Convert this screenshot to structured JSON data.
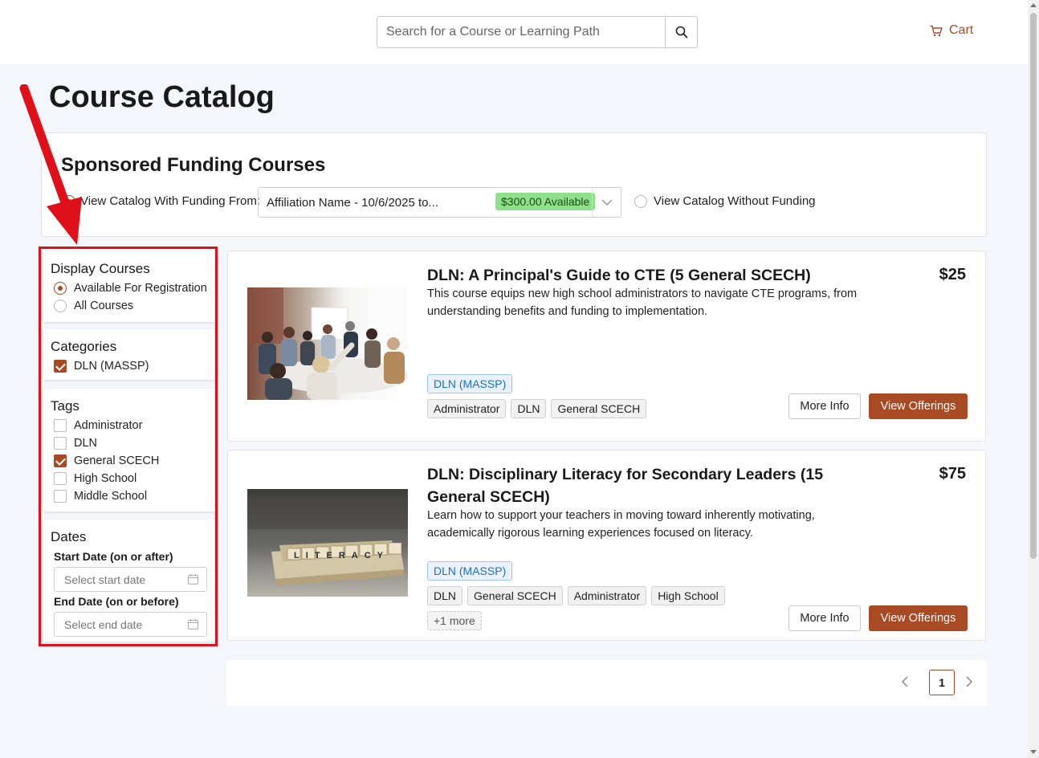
{
  "header": {
    "search_placeholder": "Search for a Course or Learning Path",
    "cart_label": "Cart"
  },
  "page_title": "Course Catalog",
  "funding": {
    "title": "Sponsored Funding Courses",
    "with_label": "View Catalog With Funding From:",
    "selected": "Affiliation Name - 10/6/2025 to...",
    "badge": "$300.00 Available",
    "without_label": "View Catalog Without Funding"
  },
  "filters": {
    "display": {
      "title": "Display Courses",
      "options": [
        "Available For Registration",
        "All Courses"
      ]
    },
    "categories": {
      "title": "Categories",
      "items": [
        "DLN (MASSP)"
      ]
    },
    "tags": {
      "title": "Tags",
      "items": [
        "Administrator",
        "DLN",
        "General SCECH",
        "High School",
        "Middle School"
      ]
    },
    "dates": {
      "title": "Dates",
      "start_label": "Start Date (on or after)",
      "start_placeholder": "Select start date",
      "end_label": "End Date (on or before)",
      "end_placeholder": "Select end date"
    }
  },
  "courses": [
    {
      "title": "DLN: A Principal's Guide to CTE (5 General SCECH)",
      "desc": "This course equips new high school administrators to navigate CTE programs, from understanding benefits and funding to implementation.",
      "price": "$25",
      "category": "DLN (MASSP)",
      "tags": [
        "Administrator",
        "DLN",
        "General SCECH"
      ],
      "more_info": "More Info",
      "view": "View Offerings"
    },
    {
      "title": "DLN: Disciplinary Literacy for Secondary Leaders (15 General SCECH)",
      "desc": "Learn how to support your teachers in moving toward inherently motivating, academically rigorous learning experiences focused on literacy.",
      "price": "$75",
      "category": "DLN (MASSP)",
      "tags": [
        "DLN",
        "General SCECH",
        "Administrator",
        "High School"
      ],
      "more_tags": "+1 more",
      "more_info": "More Info",
      "view": "View Offerings",
      "image_text": "LITERACY"
    }
  ],
  "pagination": {
    "current": "1"
  },
  "colors": {
    "accent": "#a84a23",
    "highlight": "#e0101b",
    "badge": "#8fe08a"
  }
}
